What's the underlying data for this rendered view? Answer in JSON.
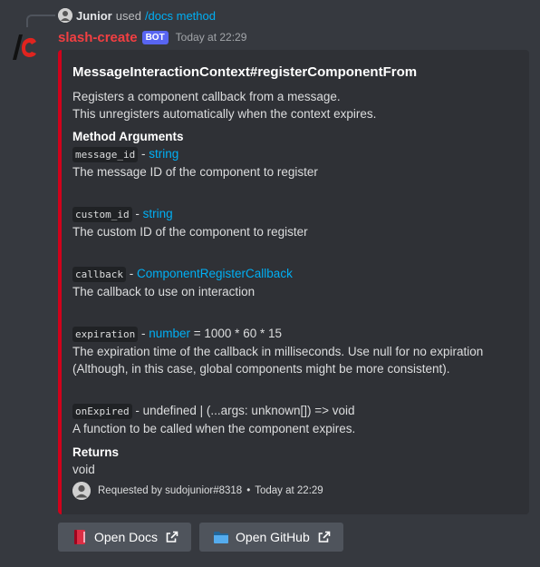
{
  "reply": {
    "user": "Junior",
    "verb": "used",
    "command": "/docs method"
  },
  "message": {
    "author": "slash-create",
    "bot_tag": "BOT",
    "timestamp": "Today at 22:29"
  },
  "embed": {
    "accent_color": "#d0021b",
    "title": "MessageInteractionContext#registerComponentFrom",
    "description_lines": [
      "Registers a component callback from a message.",
      "This unregisters automatically when the context expires."
    ],
    "args_heading": "Method Arguments",
    "args": [
      {
        "name": "message_id",
        "sep": " - ",
        "type": "string",
        "rest": "",
        "desc": "The message ID of the component to register"
      },
      {
        "name": "custom_id",
        "sep": " - ",
        "type": "string",
        "rest": "",
        "desc": "The custom ID of the component to register"
      },
      {
        "name": "callback",
        "sep": " - ",
        "type": "ComponentRegisterCallback",
        "rest": "",
        "desc": "The callback to use on interaction"
      },
      {
        "name": "expiration",
        "sep": " - ",
        "type": "number",
        "rest": " = 1000 * 60 * 15",
        "desc": "The expiration time of the callback in milliseconds. Use null for no expiration",
        "desc2": "(Although, in this case, global components might be more consistent)."
      },
      {
        "name": "onExpired",
        "sep": " - undefined | (...args: unknown[]) => void",
        "type": "",
        "rest": "",
        "desc": "A function to be called when the component expires."
      }
    ],
    "returns_heading": "Returns",
    "returns_value": "void",
    "footer": {
      "requested_by": "Requested by sudojunior#8318",
      "separator": "•",
      "time": "Today at 22:29"
    }
  },
  "buttons": [
    {
      "label": "Open Docs",
      "emoji": "closed-book-icon"
    },
    {
      "label": "Open GitHub",
      "emoji": "blue-folder-icon"
    }
  ]
}
